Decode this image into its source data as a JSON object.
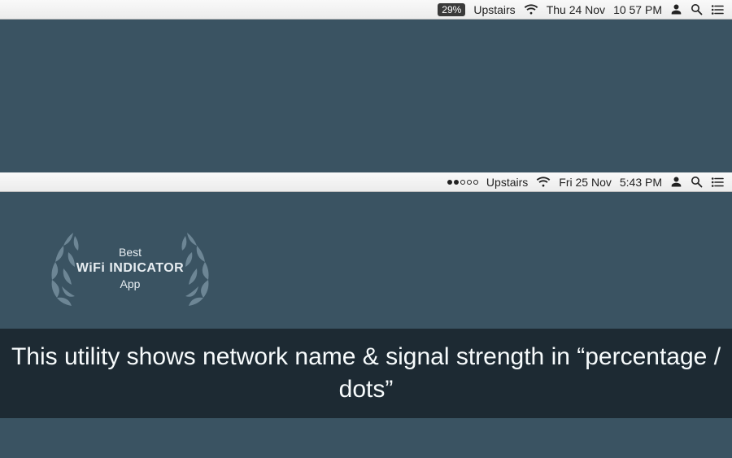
{
  "menubar_top": {
    "badge": "29%",
    "network": "Upstairs",
    "date": "Thu 24 Nov",
    "time": "10 57 PM"
  },
  "menubar_mid": {
    "dots_filled": 2,
    "dots_total": 5,
    "network": "Upstairs",
    "date": "Fri 25 Nov",
    "time": "5:43 PM"
  },
  "award": {
    "line1": "Best",
    "line2_bold": "WiFi",
    "line2_rest": "INDICATOR",
    "line3": "App"
  },
  "caption": "This utility shows network name & signal strength in “percentage / dots”"
}
